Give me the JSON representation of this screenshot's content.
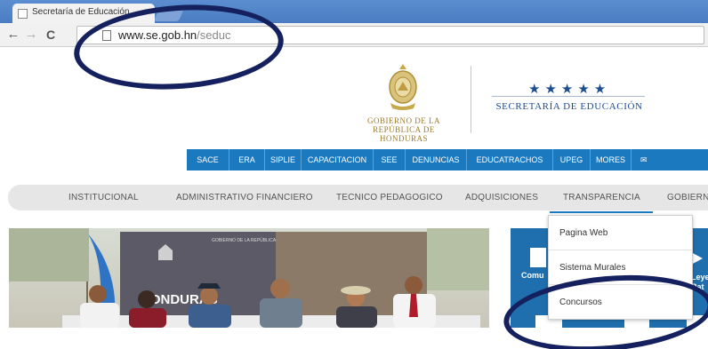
{
  "browser": {
    "tab_title": "Secretaría de Educación",
    "tab_close": "×",
    "nav": {
      "back": "←",
      "forward": "→",
      "reload": "C"
    },
    "url_host": "www.se.gob.hn",
    "url_path": "/seduc"
  },
  "header": {
    "gov_line1": "GOBIERNO DE LA",
    "gov_line2": "REPÚBLICA DE HONDURAS",
    "stars": "★★★★★",
    "secretaria": "SECRETARÍA DE EDUCACIÓN"
  },
  "quick_links": [
    "SACE",
    "ERA",
    "SIPLIE",
    "CAPACITACION",
    "SEE",
    "DENUNCIAS",
    "EDUCATRACHOS",
    "UPEG",
    "MORES"
  ],
  "quick_links_mail_icon": "✉",
  "main_nav": [
    "INSTITUCIONAL",
    "ADMINISTRATIVO FINANCIERO",
    "TECNICO PEDAGOGICO",
    "ADQUISICIONES",
    "TRANSPARENCIA",
    "GOBIERNO"
  ],
  "transparencia_menu": [
    "Pagina Web",
    "Sistema Murales",
    "Concursos"
  ],
  "hero": {
    "banner_line1": "HONDURAS",
    "banner_line2": "GOBIERNO DE LA REPÚBLICA"
  },
  "panel": {
    "left_label": "Comu",
    "right_label_1": "Leye",
    "right_label_2": "Rat"
  },
  "colors": {
    "quick_link_bar": "#1b79c0",
    "annotation": "#15215e",
    "gov_gold": "#9b7d2e",
    "secretaria_blue": "#1d4d8f"
  }
}
